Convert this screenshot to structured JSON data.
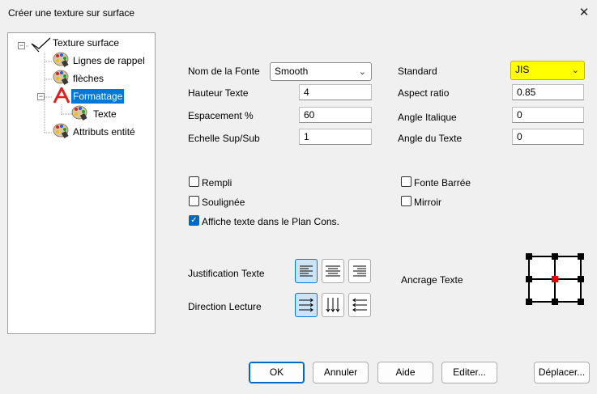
{
  "window": {
    "title": "Créer une texture sur surface",
    "close_glyph": "✕"
  },
  "tree": {
    "root": "Texture surface",
    "items": [
      "Lignes de rappel",
      "flèches",
      "Formattage",
      "Texte",
      "Attributs entité"
    ],
    "selected": "Formattage"
  },
  "fields": {
    "font_label": "Nom de la Fonte",
    "font_value": "Smooth",
    "height_label": "Hauteur Texte",
    "height_value": "4",
    "spacing_label": "Espacement %",
    "spacing_value": "60",
    "scale_label": "Echelle Sup/Sub",
    "scale_value": "1",
    "standard_label": "Standard",
    "standard_value": "JIS",
    "aspect_label": "Aspect ratio",
    "aspect_value": "0.85",
    "italic_label": "Angle Italique",
    "italic_value": "0",
    "angle_label": "Angle du Texte",
    "angle_value": "0"
  },
  "checks": {
    "filled": {
      "label": "Rempli",
      "checked": false
    },
    "strike": {
      "label": "Fonte Barrée",
      "checked": false
    },
    "underline": {
      "label": "Soulignée",
      "checked": false
    },
    "mirror": {
      "label": "Mirroir",
      "checked": false
    },
    "show_in_plane": {
      "label": "Affiche texte dans le Plan Cons.",
      "checked": true
    }
  },
  "justification_label": "Justification Texte",
  "direction_label": "Direction Lecture",
  "anchor_label": "Ancrage Texte",
  "buttons": {
    "ok": "OK",
    "cancel": "Annuler",
    "help": "Aide",
    "edit": "Editer...",
    "move": "Déplacer..."
  },
  "colors": {
    "highlight": "#ffff00",
    "selection": "#0078d7",
    "anchor_selected": "#e00000"
  }
}
